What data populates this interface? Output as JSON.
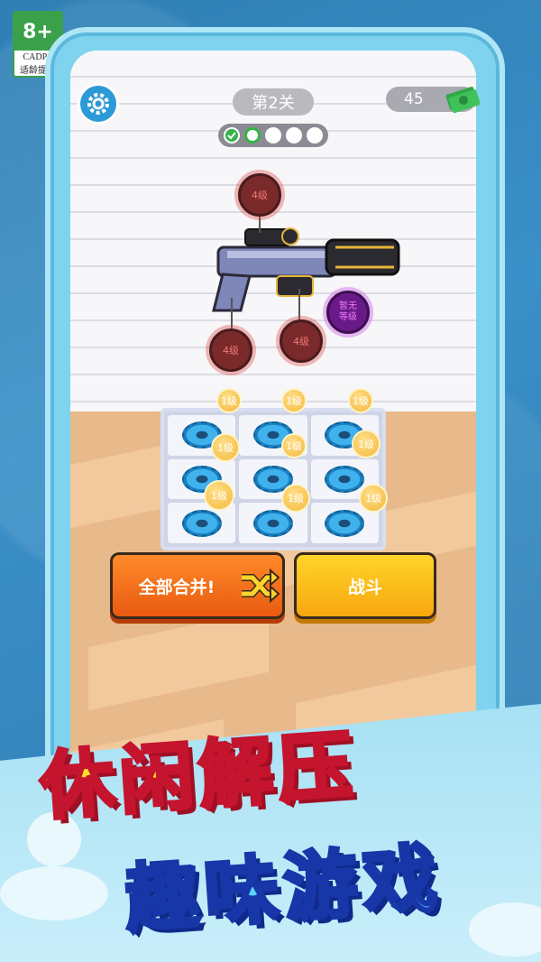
{
  "age_rating": {
    "age": "8+",
    "org": "CADPA",
    "caption": "适龄提示"
  },
  "hud": {
    "level": "第2关",
    "money": "45",
    "progress": {
      "completed": 1,
      "current": 2,
      "total": 5
    }
  },
  "gun_slots": [
    {
      "label": "4级",
      "color": "#d94a4a"
    },
    {
      "label": "4级",
      "color": "#d94a4a"
    },
    {
      "label": "4级",
      "color": "#d94a4a"
    },
    {
      "label": "暂无\n等级",
      "color": "#c23ee0"
    }
  ],
  "grid": {
    "coin_labels": [
      "1级",
      "1级",
      "1级",
      "1级",
      "1级",
      "1级",
      "1级",
      "1级",
      "1级"
    ]
  },
  "buttons": {
    "merge_all": "全部合并!",
    "fight": "战斗"
  },
  "banner": {
    "line1": "休闲解压",
    "line2": "趣味游戏"
  },
  "colors": {
    "accent_orange": "#e85a10",
    "accent_yellow": "#f7a70e",
    "progress_green": "#35b44a"
  }
}
